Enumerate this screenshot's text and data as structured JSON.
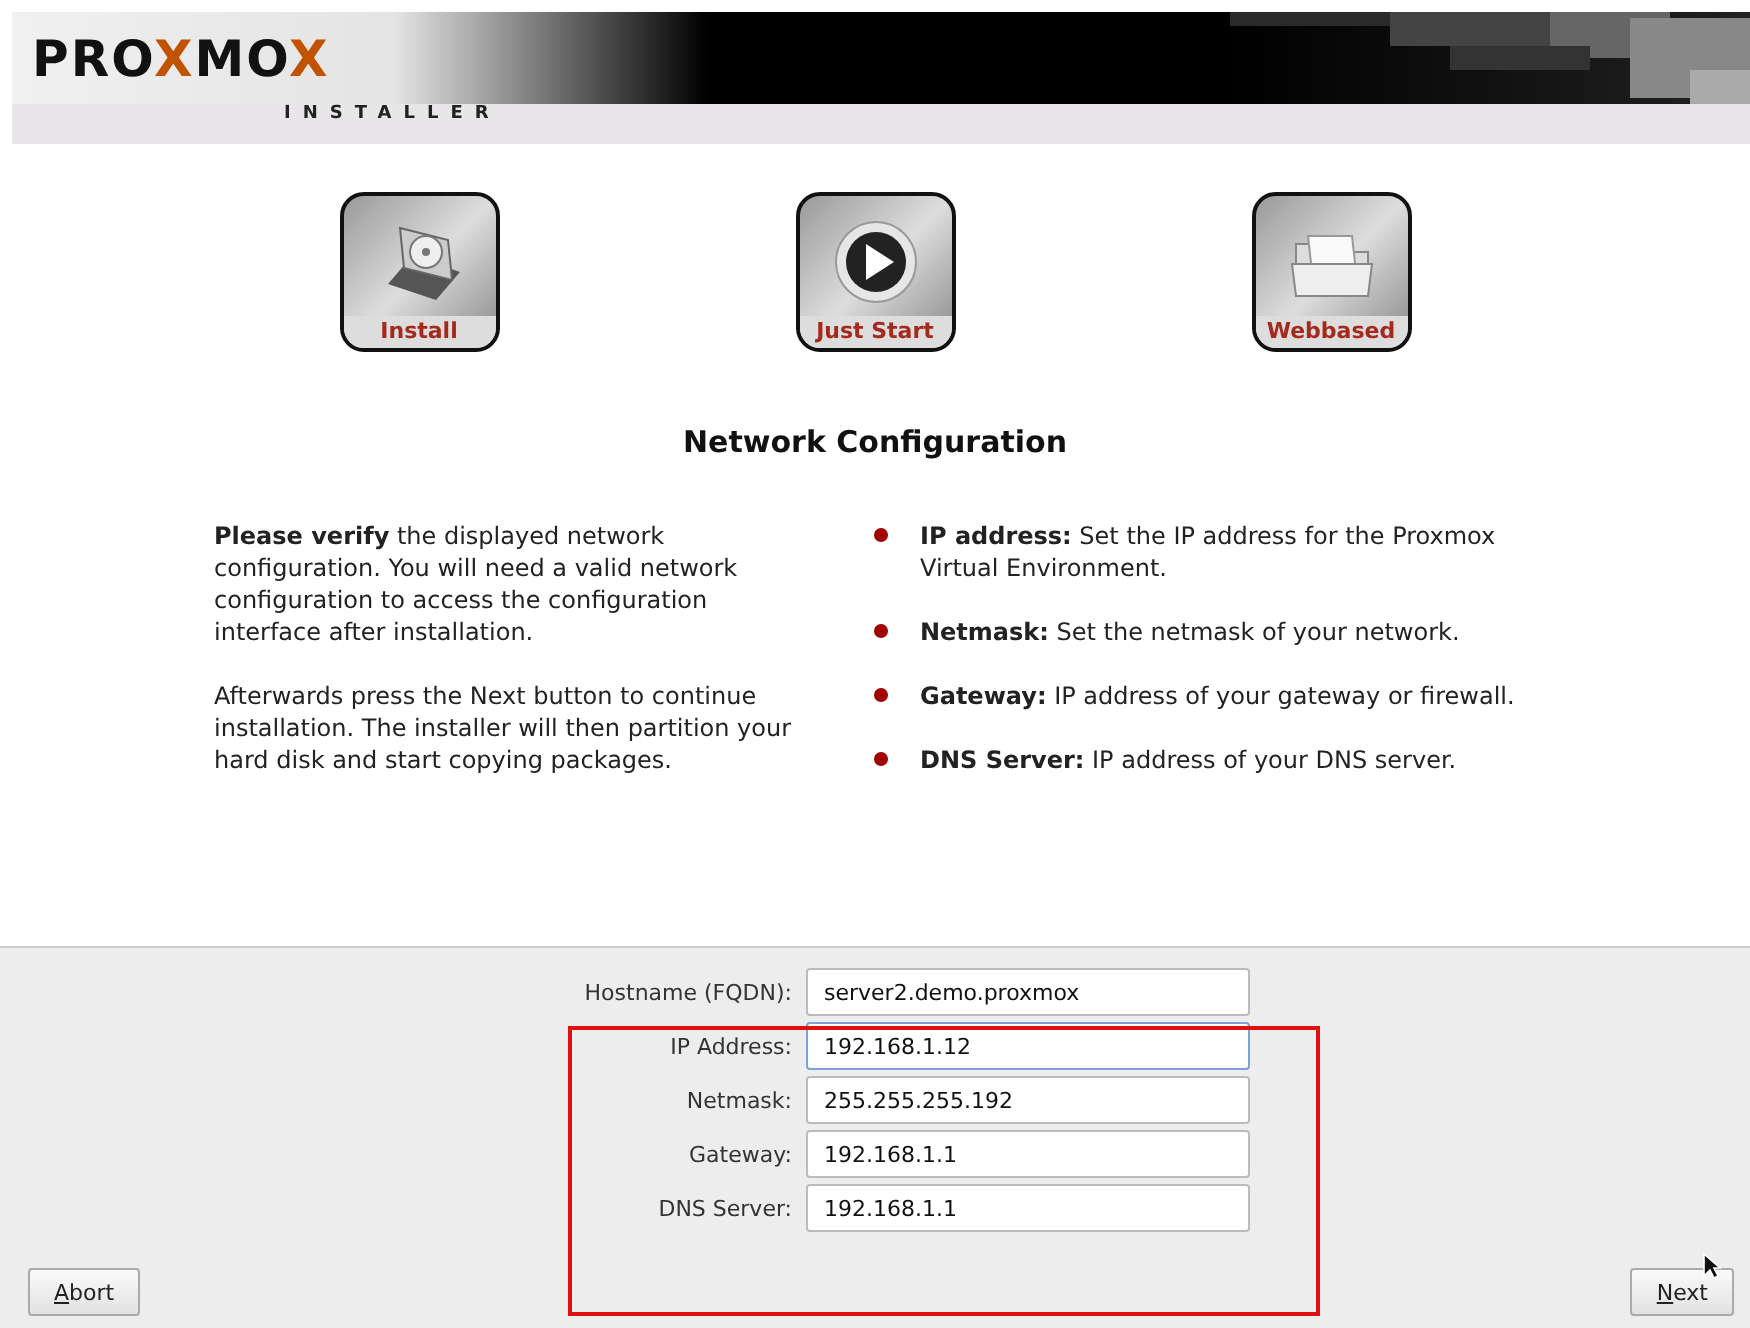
{
  "header": {
    "logo": [
      {
        "text": "PRO",
        "accent": false
      },
      {
        "text": "X",
        "accent": true
      },
      {
        "text": "MO",
        "accent": false
      },
      {
        "text": "X",
        "accent": true
      }
    ],
    "subtitle": "INSTALLER"
  },
  "modes": [
    {
      "label": "Install",
      "kind": "disk"
    },
    {
      "label": "Just Start",
      "kind": "play"
    },
    {
      "label": "Webbased",
      "kind": "folder"
    }
  ],
  "title": "Network Configuration",
  "intro": [
    "**Please verify** the displayed network configuration. You will need a valid network configuration to access the configuration interface after installation.",
    "Afterwards press the Next button to continue installation. The installer will then partition your hard disk and start copying packages."
  ],
  "tips": [
    "**IP address:** Set the IP address for the Proxmox Virtual Environment.",
    "**Netmask:** Set the netmask of your network.",
    "**Gateway:** IP address of your gateway or firewall.",
    "**DNS Server:** IP address of your DNS server."
  ],
  "form": [
    {
      "label": "Hostname (FQDN):",
      "value": "server2.demo.proxmox",
      "focused": false
    },
    {
      "label": "IP Address:",
      "value": "192.168.1.12",
      "focused": true
    },
    {
      "label": "Netmask:",
      "value": "255.255.255.192",
      "focused": false
    },
    {
      "label": "Gateway:",
      "value": "192.168.1.1",
      "focused": false
    },
    {
      "label": "DNS Server:",
      "value": "192.168.1.1",
      "focused": false
    }
  ],
  "buttons": {
    "abort": "Abort",
    "next": "Next"
  }
}
